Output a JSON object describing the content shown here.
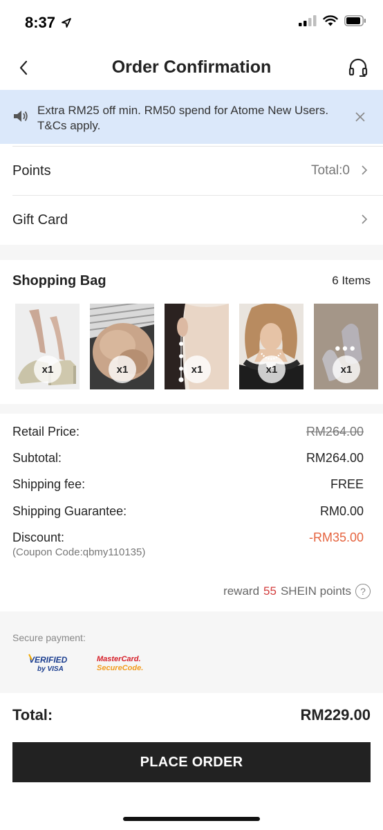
{
  "status_bar": {
    "time": "8:37",
    "icons": [
      "location-arrow-icon",
      "cellular-signal-icon",
      "wifi-icon",
      "battery-icon"
    ]
  },
  "header": {
    "title": "Order Confirmation",
    "back_icon": "chevron-left-icon",
    "support_icon": "headset-icon"
  },
  "promo": {
    "text": "Extra RM25 off min. RM50 spend for Atome New Users. T&Cs apply.",
    "icon": "speaker-icon",
    "close_icon": "close-icon",
    "background": "#dbe8fa"
  },
  "points": {
    "label": "Points",
    "value": "Total:0"
  },
  "gift_card": {
    "label": "Gift Card"
  },
  "shopping_bag": {
    "title": "Shopping Bag",
    "count": "6 Items",
    "items": [
      {
        "name": "heeled-sandals",
        "qty": "x1"
      },
      {
        "name": "faux-fur-bag",
        "qty": "x1"
      },
      {
        "name": "pearl-drop-earrings",
        "qty": "x1"
      },
      {
        "name": "pearl-necklace",
        "qty": "x1"
      },
      {
        "name": "lace-gloves",
        "qty": "x1",
        "more": "•••"
      }
    ]
  },
  "summary": {
    "retail_label": "Retail Price:",
    "retail_value": "RM264.00",
    "subtotal_label": "Subtotal:",
    "subtotal_value": "RM264.00",
    "shipping_label": "Shipping fee:",
    "shipping_value": "FREE",
    "guarantee_label": "Shipping Guarantee:",
    "guarantee_value": "RM0.00",
    "discount_label": "Discount:",
    "discount_value": "-RM35.00",
    "coupon_text": "(Coupon Code:qbmy110135)"
  },
  "reward": {
    "prefix": "reward",
    "points": "55",
    "suffix": "SHEIN points",
    "help_icon": "?"
  },
  "secure_payment": {
    "label": "Secure payment:",
    "badges": {
      "verified_line1": "VERIFIED",
      "verified_line2": "by VISA",
      "mastercard_line1": "MasterCard.",
      "mastercard_line2": "SecureCode."
    }
  },
  "total": {
    "label": "Total:",
    "value": "RM229.00"
  },
  "place_order": {
    "label": "PLACE ORDER"
  },
  "colors": {
    "accent_dark": "#222222",
    "discount": "#e5633e",
    "reward_points": "#d23c3c",
    "promo_bg": "#dbe8fa"
  }
}
